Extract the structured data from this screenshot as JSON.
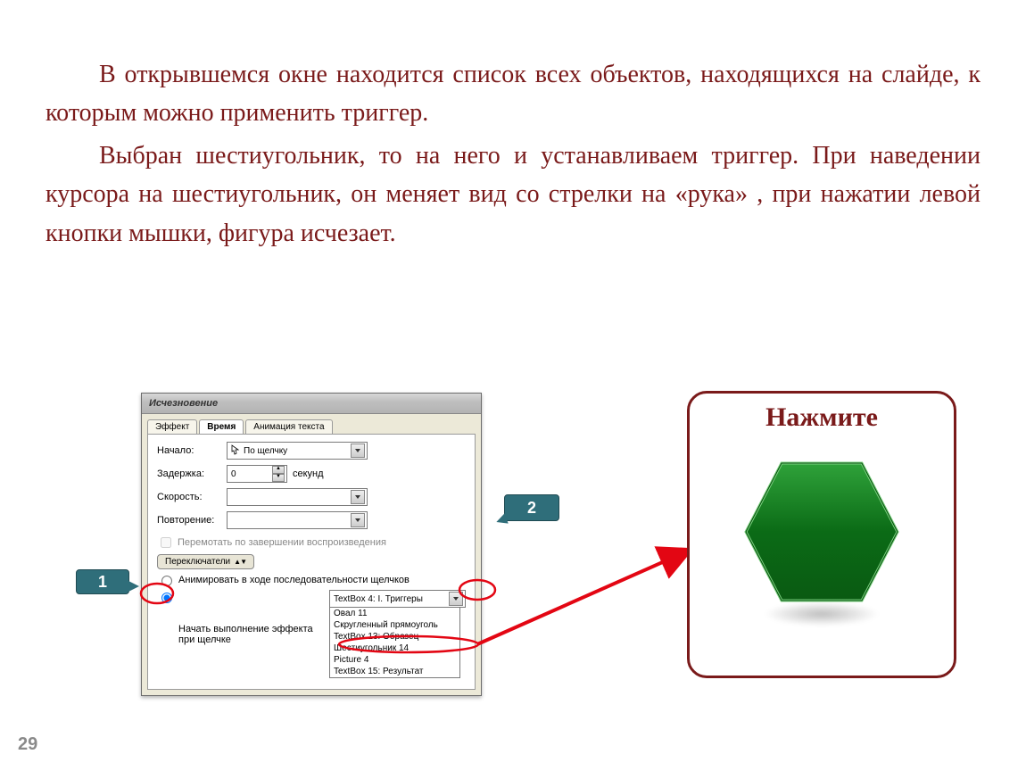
{
  "page_number": "29",
  "paragraphs": {
    "p1": "В открывшемся окне находится список всех объектов, находящихся на слайде, к которым можно применить триггер.",
    "p2": "Выбран шестиугольник, то на него и устанавливаем триггер. При наведении курсора на шестиугольник, он меняет вид со стрелки на «рука» , при нажатии левой кнопки мышки, фигура исчезает."
  },
  "dialog": {
    "title": "Исчезновение",
    "tabs": {
      "effect": "Эффект",
      "time": "Время",
      "text_anim": "Анимация текста"
    },
    "fields": {
      "start_label": "Начало:",
      "start_value": "По щелчку",
      "delay_label": "Задержка:",
      "delay_value": "0",
      "delay_unit": "секунд",
      "speed_label": "Скорость:",
      "speed_value": "",
      "repeat_label": "Повторение:",
      "repeat_value": "",
      "rewind_label": "Перемотать по завершении воспроизведения",
      "switches_label": "Переключатели",
      "radio_seq": "Анимировать в ходе последовательности щелчков",
      "radio_trigger": "Начать выполнение эффекта при щелчке",
      "trigger_selected": "TextBox 4: I. Триггеры",
      "list": [
        "Овал 11",
        "Скругленный прямоуголь",
        "TextBox 13: Образец",
        "Шестиугольник 14",
        "Picture 4",
        "TextBox 15: Результат"
      ]
    }
  },
  "callouts": {
    "one": "1",
    "two": "2"
  },
  "press_panel": {
    "title": "Нажмите"
  }
}
